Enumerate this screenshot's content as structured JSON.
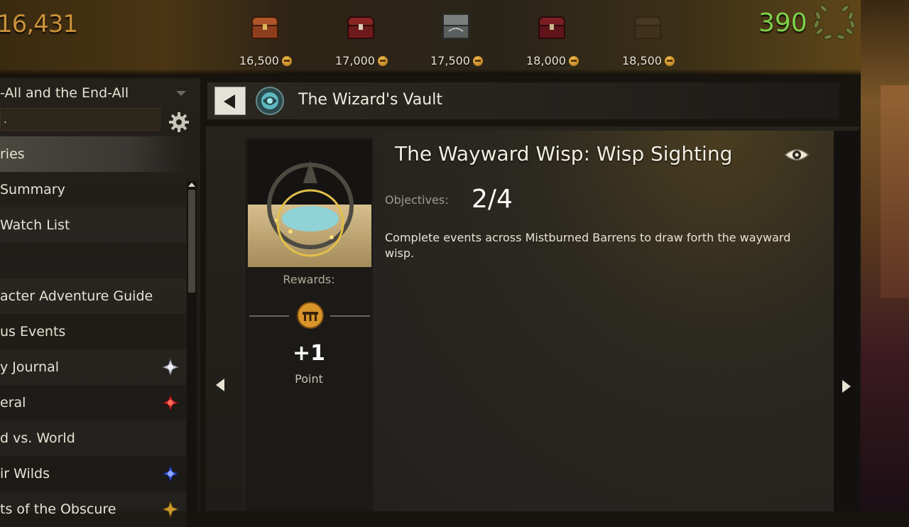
{
  "top_track": {
    "total_points": "16,431",
    "chests": [
      {
        "icon": "orange-chest-icon",
        "cost": "16,500",
        "color": "#b0552a"
      },
      {
        "icon": "red-chest-icon",
        "cost": "17,000",
        "color": "#8a2424"
      },
      {
        "icon": "steel-chest-icon",
        "cost": "17,500",
        "color": "#6e7270"
      },
      {
        "icon": "red-chest-icon",
        "cost": "18,000",
        "color": "#7a1e22"
      },
      {
        "icon": "faded-chest-icon",
        "cost": "18,500",
        "color": "#5a4630"
      }
    ],
    "legacy_count": "390",
    "legacy_icon": "laurel-wreath-icon"
  },
  "sidebar": {
    "collection_select": "-All and the End-All",
    "search_value": ".",
    "items": [
      {
        "label": "ries",
        "selected": true,
        "badge": null
      },
      {
        "label": "Summary",
        "selected": false,
        "badge": null
      },
      {
        "label": "Watch List",
        "selected": false,
        "badge": null
      },
      {
        "label": "",
        "selected": false,
        "badge": null
      },
      {
        "label": "acter Adventure Guide",
        "selected": false,
        "badge": null
      },
      {
        "label": "us Events",
        "selected": false,
        "badge": null
      },
      {
        "label": "y Journal",
        "selected": false,
        "badge": "silver-star-icon"
      },
      {
        "label": "eral",
        "selected": false,
        "badge": "red-star-icon"
      },
      {
        "label": "d vs. World",
        "selected": false,
        "badge": null
      },
      {
        "label": "ir Wilds",
        "selected": false,
        "badge": "blue-star-icon"
      },
      {
        "label": "ts of the Obscure",
        "selected": false,
        "badge": "gold-star-icon"
      }
    ]
  },
  "header": {
    "title": "The Wizard's Vault",
    "back_icon": "back-arrow-icon",
    "vault_icon": "wizards-vault-icon"
  },
  "objective": {
    "title": "The Wayward Wisp: Wisp Sighting",
    "objectives_label": "Objectives:",
    "progress": "2/4",
    "description": "Complete events across Mistburned Barrens to draw forth the wayward wisp.",
    "rewards_label": "Rewards:",
    "reward_amount": "+1",
    "reward_unit": "Point",
    "reward_icon": "astral-acclaim-coin-icon"
  },
  "colors": {
    "accent_gold": "#c8913a",
    "legacy_green": "#7ed24a",
    "text": "#e8e2d4"
  }
}
